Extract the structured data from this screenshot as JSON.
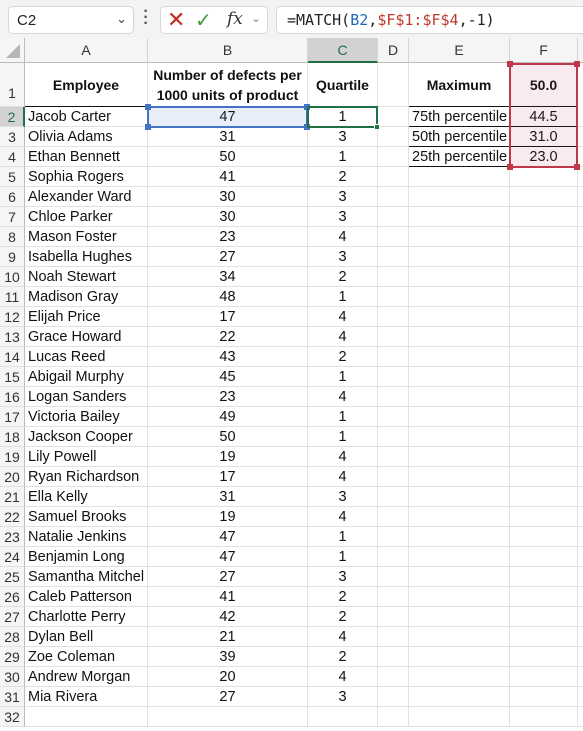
{
  "formula_bar": {
    "name_box": "C2",
    "formula_prefix": "=MATCH(",
    "formula_ref1": "B2",
    "formula_sep1": ",",
    "formula_ref2": "$F$1:$F$4",
    "formula_suffix": ",-1)",
    "cancel_icon": "✕",
    "enter_icon": "✓",
    "fx_label": "fx"
  },
  "columns": [
    "A",
    "B",
    "C",
    "D",
    "E",
    "F"
  ],
  "selected_cell": "C2",
  "headers": {
    "employee": "Employee",
    "defects": "Number of defects per 1000 units of product",
    "quartile": "Quartile",
    "maximum_label": "Maximum",
    "maximum_value": "50.0"
  },
  "percentiles": [
    {
      "label": "75th percentile",
      "value": "44.5"
    },
    {
      "label": "50th percentile",
      "value": "31.0"
    },
    {
      "label": "25th percentile",
      "value": "23.0"
    }
  ],
  "rows": [
    {
      "name": "Jacob Carter",
      "defects": "47",
      "quartile": "1"
    },
    {
      "name": "Olivia Adams",
      "defects": "31",
      "quartile": "3"
    },
    {
      "name": "Ethan Bennett",
      "defects": "50",
      "quartile": "1"
    },
    {
      "name": "Sophia Rogers",
      "defects": "41",
      "quartile": "2"
    },
    {
      "name": "Alexander Ward",
      "defects": "30",
      "quartile": "3"
    },
    {
      "name": "Chloe Parker",
      "defects": "30",
      "quartile": "3"
    },
    {
      "name": "Mason Foster",
      "defects": "23",
      "quartile": "4"
    },
    {
      "name": "Isabella Hughes",
      "defects": "27",
      "quartile": "3"
    },
    {
      "name": "Noah Stewart",
      "defects": "34",
      "quartile": "2"
    },
    {
      "name": "Madison Gray",
      "defects": "48",
      "quartile": "1"
    },
    {
      "name": "Elijah Price",
      "defects": "17",
      "quartile": "4"
    },
    {
      "name": "Grace Howard",
      "defects": "22",
      "quartile": "4"
    },
    {
      "name": "Lucas Reed",
      "defects": "43",
      "quartile": "2"
    },
    {
      "name": "Abigail Murphy",
      "defects": "45",
      "quartile": "1"
    },
    {
      "name": "Logan Sanders",
      "defects": "23",
      "quartile": "4"
    },
    {
      "name": "Victoria Bailey",
      "defects": "49",
      "quartile": "1"
    },
    {
      "name": "Jackson Cooper",
      "defects": "50",
      "quartile": "1"
    },
    {
      "name": "Lily Powell",
      "defects": "19",
      "quartile": "4"
    },
    {
      "name": "Ryan Richardson",
      "defects": "17",
      "quartile": "4"
    },
    {
      "name": "Ella Kelly",
      "defects": "31",
      "quartile": "3"
    },
    {
      "name": "Samuel Brooks",
      "defects": "19",
      "quartile": "4"
    },
    {
      "name": "Natalie Jenkins",
      "defects": "47",
      "quartile": "1"
    },
    {
      "name": "Benjamin Long",
      "defects": "47",
      "quartile": "1"
    },
    {
      "name": "Samantha Mitchel",
      "defects": "27",
      "quartile": "3"
    },
    {
      "name": "Caleb Patterson",
      "defects": "41",
      "quartile": "2"
    },
    {
      "name": "Charlotte Perry",
      "defects": "42",
      "quartile": "2"
    },
    {
      "name": "Dylan Bell",
      "defects": "21",
      "quartile": "4"
    },
    {
      "name": "Zoe Coleman",
      "defects": "39",
      "quartile": "2"
    },
    {
      "name": "Andrew Morgan",
      "defects": "20",
      "quartile": "4"
    },
    {
      "name": "Mia Rivera",
      "defects": "27",
      "quartile": "3"
    }
  ],
  "row_numbers": [
    "1",
    "2",
    "3",
    "4",
    "5",
    "6",
    "7",
    "8",
    "9",
    "10",
    "11",
    "12",
    "13",
    "14",
    "15",
    "16",
    "17",
    "18",
    "19",
    "20",
    "21",
    "22",
    "23",
    "24",
    "25",
    "26",
    "27",
    "28",
    "29",
    "30",
    "31",
    "32"
  ]
}
